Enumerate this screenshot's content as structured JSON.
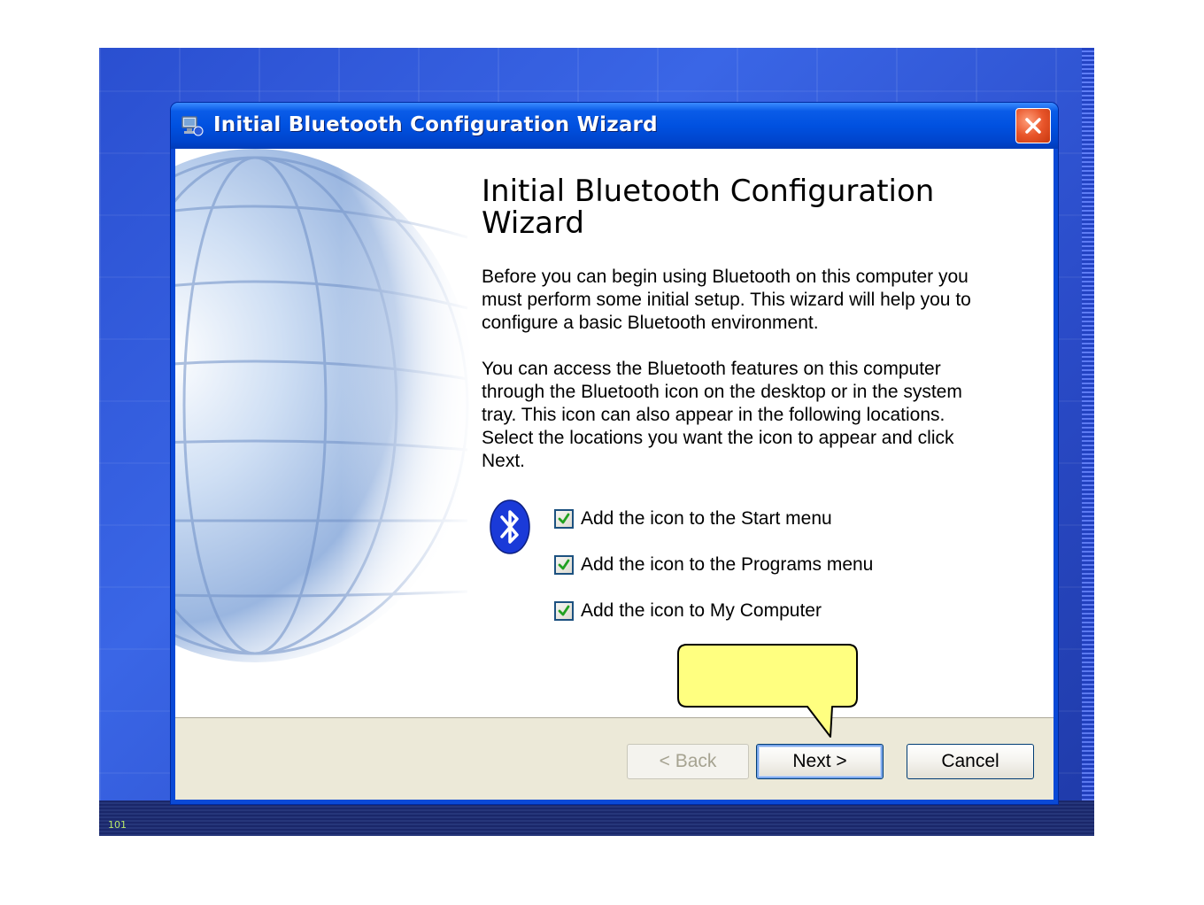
{
  "window": {
    "title": "Initial Bluetooth Configuration Wizard"
  },
  "wizard": {
    "heading": "Initial Bluetooth Configuration Wizard",
    "paragraph_1": "Before you can begin using Bluetooth on this computer you must perform some initial setup. This wizard will help you to configure a basic Bluetooth environment.",
    "paragraph_2": "You can access the Bluetooth features on this computer through the Bluetooth icon on the desktop or in the system tray. This icon can also appear in the following locations. Select the locations you want the icon to appear and click Next.",
    "options": [
      {
        "label": "Add the icon to the Start menu",
        "checked": true
      },
      {
        "label": "Add the icon to the Programs menu",
        "checked": true
      },
      {
        "label": "Add the icon to My Computer",
        "checked": true
      }
    ]
  },
  "buttons": {
    "back_label": "< Back",
    "back_enabled": false,
    "next_label": "Next >",
    "cancel_label": "Cancel"
  },
  "taskbar": {
    "tray_text": "101"
  },
  "colors": {
    "titlebar": "#0051e0",
    "button_bar": "#ece9d8",
    "callout_fill": "#ffff80",
    "close_button": "#e8552a",
    "bluetooth_blue": "#1a3ad8"
  },
  "icons": {
    "title": "bluetooth-wizard-icon",
    "close": "close-icon",
    "logo": "bluetooth-icon",
    "check": "checkmark-icon"
  }
}
